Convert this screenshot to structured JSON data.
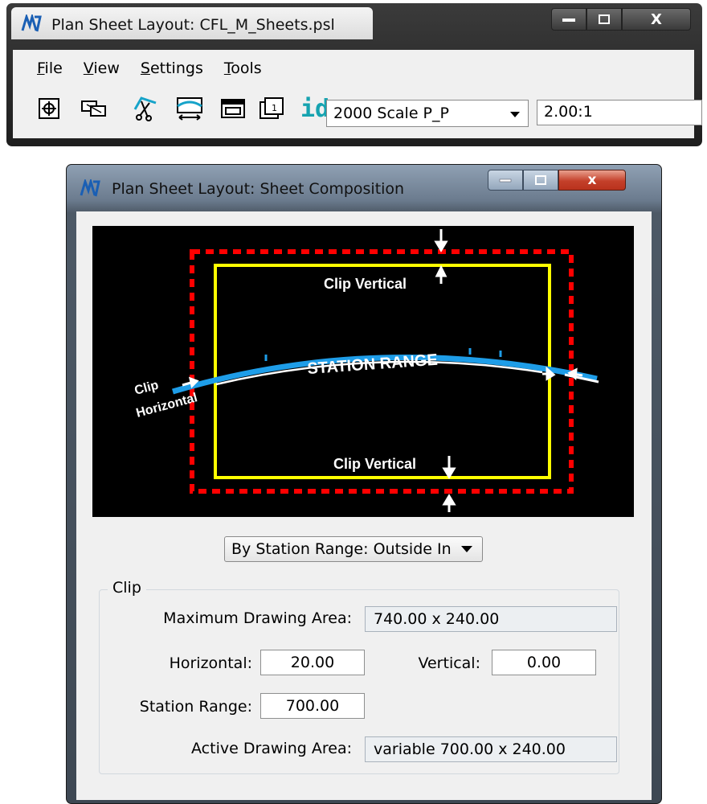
{
  "main_window": {
    "title": "Plan Sheet Layout: CFL_M_Sheets.psl",
    "menu": [
      {
        "accel": "F",
        "rest": "ile"
      },
      {
        "accel": "V",
        "rest": "iew"
      },
      {
        "accel": "S",
        "rest": "ettings"
      },
      {
        "accel": "T",
        "rest": "ools"
      }
    ],
    "toolbar": {
      "id_label": "id",
      "scale_select": "2000 Scale P_P",
      "ratio_value": "2.00:1"
    },
    "caption": {
      "minimize": "‒",
      "close": "X"
    }
  },
  "composition_window": {
    "title": "Plan Sheet Layout: Sheet Composition",
    "caption": {
      "minimize": "‒",
      "close": "x"
    },
    "preview": {
      "clip_vertical_top": "Clip Vertical",
      "clip_vertical_bottom": "Clip Vertical",
      "station_range": "STATION RANGE",
      "clip_horizontal_1": "Clip",
      "clip_horizontal_2": "Horizontal",
      "colors": {
        "frame": "#ffff00",
        "clip_boundary": "#ff0000",
        "alignment": "#1e9de8",
        "background": "#000000"
      }
    },
    "method_select": "By Station Range: Outside In",
    "clip": {
      "legend": "Clip",
      "max_area_label": "Maximum Drawing Area:",
      "max_area_value": "740.00 x   240.00",
      "horizontal_label": "Horizontal:",
      "horizontal_value": "20.00",
      "vertical_label": "Vertical:",
      "vertical_value": "0.00",
      "station_range_label": "Station Range:",
      "station_range_value": "700.00",
      "active_area_label": "Active Drawing Area:",
      "active_area_value": "variable   700.00 x   240.00"
    }
  }
}
